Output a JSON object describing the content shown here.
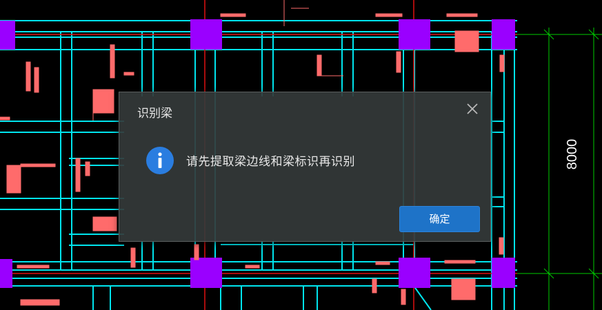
{
  "dialog": {
    "title": "识别梁",
    "message": "请先提取梁边线和梁标识再识别",
    "ok_label": "确定",
    "close_icon": "close-icon",
    "message_icon": "info-icon"
  },
  "drawing": {
    "dimension_text": "8000",
    "colors": {
      "background": "#000000",
      "beam_edge": "#00ffff",
      "axis": "#ff0000",
      "column": "#a000ff",
      "annotation": "#ff6b6b",
      "dimension": "#00ff00"
    }
  }
}
